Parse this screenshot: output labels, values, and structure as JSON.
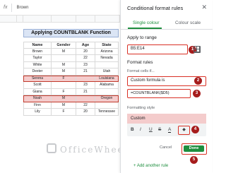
{
  "formula_bar": {
    "fx": "fx",
    "value": "Brown"
  },
  "sheet": {
    "title": "Applying COUNTBLANK Function",
    "headers": [
      "Name",
      "Gender",
      "Age",
      "State"
    ],
    "rows": [
      [
        "Brown",
        "M",
        "20",
        "Arizona"
      ],
      [
        "Taylor",
        "",
        "22",
        "Nevada"
      ],
      [
        "White",
        "M",
        "23",
        ""
      ],
      [
        "Dexter",
        "M",
        "21",
        "Utah"
      ],
      [
        "Serena",
        "F",
        "",
        "Louisiana"
      ],
      [
        "Scott",
        "",
        "23",
        "Alabama"
      ],
      [
        "Giana",
        "F",
        "21",
        ""
      ],
      [
        "Noah",
        "M",
        "",
        "Oregon"
      ],
      [
        "Finn",
        "M",
        "22",
        ""
      ],
      [
        "Lily",
        "F",
        "20",
        "Tennessee"
      ]
    ],
    "highlight_color": "#f4cccc"
  },
  "panel": {
    "title": "Conditional format rules",
    "close_icon": "close-icon",
    "tabs": [
      {
        "label": "Single colour",
        "active": true
      },
      {
        "label": "Colour scale",
        "active": false
      }
    ],
    "apply_label": "Apply to range",
    "range_value": "B5:E14",
    "rules_label": "Format rules",
    "format_cells_if": "Format cells if...",
    "condition_value": "Custom formula is",
    "formula_value": "=COUNTBLANK($D5)",
    "style_label": "Formatting style",
    "style_preview": "Custom",
    "toolbar": {
      "bold": "B",
      "italic": "I",
      "underline": "U",
      "strike": "S",
      "text_color": "A",
      "fill": "◆"
    },
    "cancel_label": "Cancel",
    "done_label": "Done",
    "add_rule_label": "+ Add another rule",
    "accent": "#1e8e3e",
    "marker_color": "#a61c1c"
  },
  "watermark": "OfficeWheel",
  "badges": [
    "1",
    "2",
    "3",
    "4",
    "5"
  ]
}
